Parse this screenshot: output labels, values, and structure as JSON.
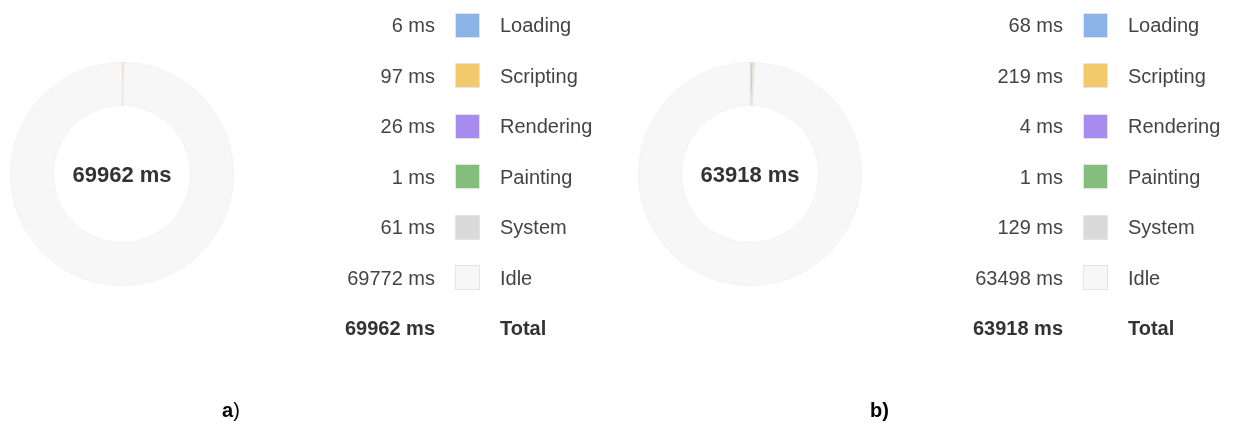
{
  "panels": [
    {
      "caption": "**a**)",
      "donut": {
        "center_label": "69962 ms"
      },
      "legend": [
        {
          "value": "6 ms",
          "label": "Loading",
          "color": "#8ab4e8"
        },
        {
          "value": "97 ms",
          "label": "Scripting",
          "color": "#f2c96b"
        },
        {
          "value": "26 ms",
          "label": "Rendering",
          "color": "#a78bef"
        },
        {
          "value": "1 ms",
          "label": "Painting",
          "color": "#83be7c"
        },
        {
          "value": "61 ms",
          "label": "System",
          "color": "#dadada"
        },
        {
          "value": "69772 ms",
          "label": "Idle",
          "color": "#f7f7f7"
        }
      ],
      "total": {
        "value": "69962 ms",
        "label": "Total"
      }
    },
    {
      "caption": "**b)**",
      "donut": {
        "center_label": "63918 ms"
      },
      "legend": [
        {
          "value": "68 ms",
          "label": "Loading",
          "color": "#8ab4e8"
        },
        {
          "value": "219 ms",
          "label": "Scripting",
          "color": "#f2c96b"
        },
        {
          "value": "4 ms",
          "label": "Rendering",
          "color": "#a78bef"
        },
        {
          "value": "1 ms",
          "label": "Painting",
          "color": "#83be7c"
        },
        {
          "value": "129 ms",
          "label": "System",
          "color": "#dadada"
        },
        {
          "value": "63498 ms",
          "label": "Idle",
          "color": "#f7f7f7"
        }
      ],
      "total": {
        "value": "63918 ms",
        "label": "Total"
      }
    }
  ]
}
